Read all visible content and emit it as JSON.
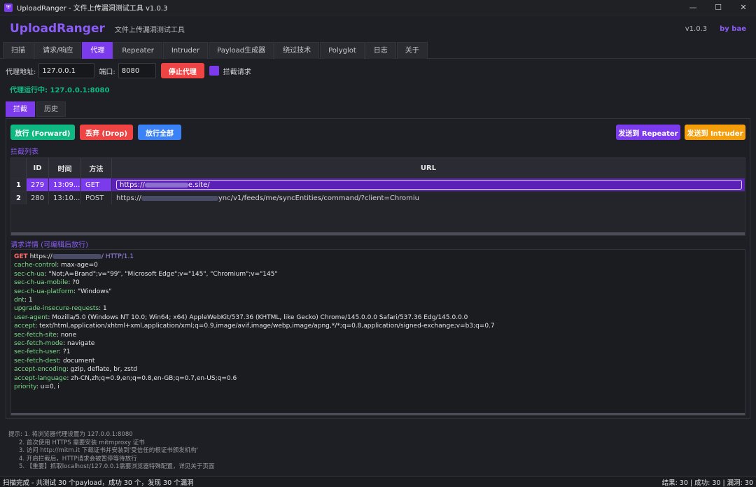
{
  "window": {
    "title": "UploadRanger - 文件上传漏洞测试工具 v1.0.3",
    "minimize": "—",
    "maximize": "☐",
    "close": "✕"
  },
  "header": {
    "brand": "UploadRanger",
    "subtitle": "文件上传漏洞测试工具",
    "version": "v1.0.3",
    "author": "by bae"
  },
  "tabs": [
    "扫描",
    "请求/响应",
    "代理",
    "Repeater",
    "Intruder",
    "Payload生成器",
    "绕过技术",
    "Polyglot",
    "日志",
    "关于"
  ],
  "active_tab": "代理",
  "proxy": {
    "address_label": "代理地址:",
    "address_value": "127.0.0.1",
    "port_label": "端口:",
    "port_value": "8080",
    "stop_button": "停止代理",
    "intercept_label": "拦截请求",
    "status": "代理运行中: 127.0.0.1:8080"
  },
  "subtabs": [
    "拦截",
    "历史"
  ],
  "actions": {
    "forward": "放行 (Forward)",
    "drop": "丢弃 (Drop)",
    "forward_all": "放行全部",
    "send_repeater": "发送到 Repeater",
    "send_intruder": "发送到 Intruder"
  },
  "intercept_list": {
    "label": "拦截列表",
    "columns": [
      "ID",
      "时间",
      "方法",
      "URL"
    ],
    "rows": [
      {
        "num": "1",
        "id": "279",
        "time": "13:09...",
        "method": "GET",
        "url_prefix": "https://",
        "url_suffix": "e.site/"
      },
      {
        "num": "2",
        "id": "280",
        "time": "13:10...",
        "method": "POST",
        "url_prefix": "https://",
        "url_suffix": "ync/v1/feeds/me/syncEntities/command/?client=Chromiu"
      }
    ]
  },
  "detail": {
    "label": "请求详情 (可编辑后放行)",
    "request_line": {
      "method": "GET",
      "prefix": "https://",
      "suffix": "/ HTTP/1.1"
    },
    "headers": [
      {
        "k": "cache-control",
        "v": "max-age=0"
      },
      {
        "k": "sec-ch-ua",
        "v": "\"Not;A=Brand\";v=\"99\", \"Microsoft Edge\";v=\"145\", \"Chromium\";v=\"145\""
      },
      {
        "k": "sec-ch-ua-mobile",
        "v": "?0"
      },
      {
        "k": "sec-ch-ua-platform",
        "v": "\"Windows\""
      },
      {
        "k": "dnt",
        "v": "1"
      },
      {
        "k": "upgrade-insecure-requests",
        "v": "1"
      },
      {
        "k": "user-agent",
        "v": "Mozilla/5.0 (Windows NT 10.0; Win64; x64) AppleWebKit/537.36 (KHTML, like Gecko) Chrome/145.0.0.0 Safari/537.36 Edg/145.0.0.0"
      },
      {
        "k": "accept",
        "v": "text/html,application/xhtml+xml,application/xml;q=0.9,image/avif,image/webp,image/apng,*/*;q=0.8,application/signed-exchange;v=b3;q=0.7"
      },
      {
        "k": "sec-fetch-site",
        "v": "none"
      },
      {
        "k": "sec-fetch-mode",
        "v": "navigate"
      },
      {
        "k": "sec-fetch-user",
        "v": "?1"
      },
      {
        "k": "sec-fetch-dest",
        "v": "document"
      },
      {
        "k": "accept-encoding",
        "v": "gzip, deflate, br, zstd"
      },
      {
        "k": "accept-language",
        "v": "zh-CN,zh;q=0.9,en;q=0.8,en-GB;q=0.7,en-US;q=0.6"
      },
      {
        "k": "priority",
        "v": "u=0, i"
      }
    ]
  },
  "tips": [
    "提示: 1. 将浏览器代理设置为 127.0.0.1:8080",
    "2. 首次使用 HTTPS 需要安装 mitmproxy 证书",
    "3. 访问 http://mitm.it 下载证书并安装到'受信任的根证书颁发机构'",
    "4. 开启拦截后，HTTP请求会被暂停等待放行",
    "5. 【重要】抓取localhost/127.0.0.1需要浏览器特殊配置，详见关于页面"
  ],
  "statusbar": {
    "left": "扫描完成 - 共测试 30 个payload，成功 30 个，发现 30 个漏洞",
    "right": "结果: 30 | 成功: 30 | 漏洞: 30"
  },
  "colors": {
    "accent": "#7c3aed",
    "success": "#10b981",
    "danger": "#ef4444",
    "info": "#3b82f6",
    "warning": "#f59e0b"
  }
}
